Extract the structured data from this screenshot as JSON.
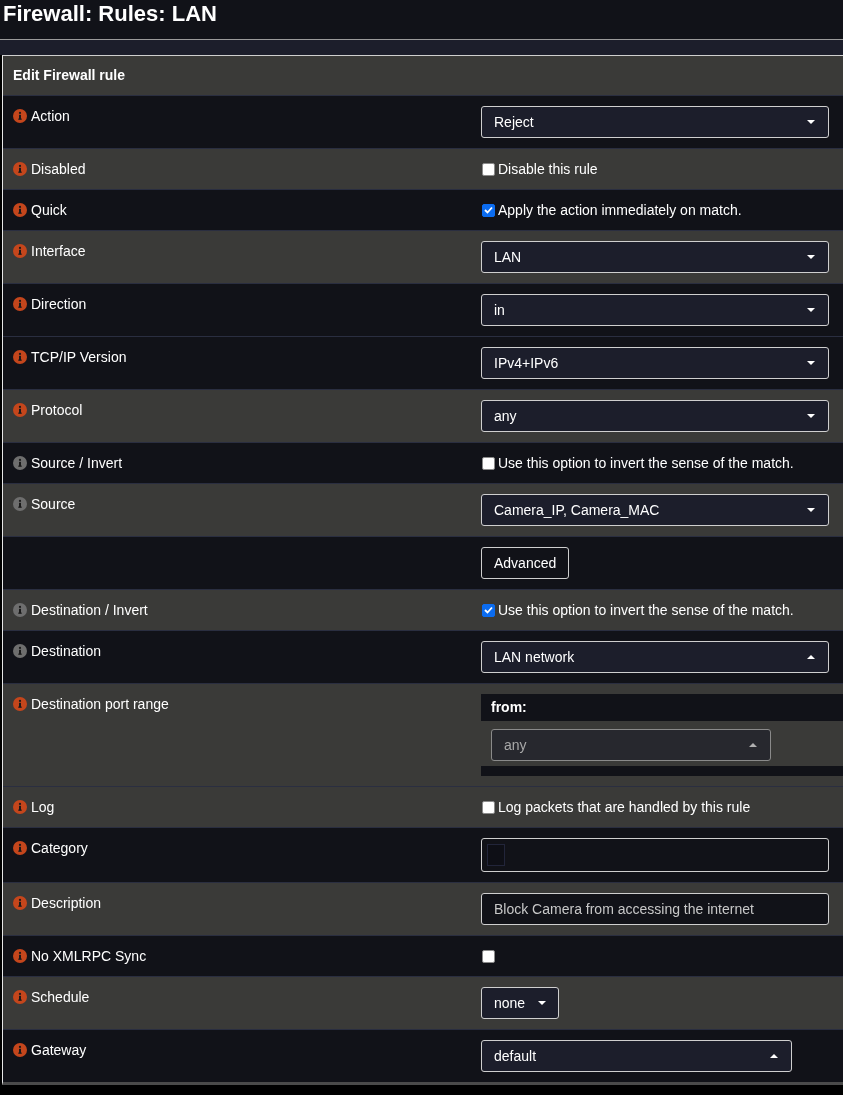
{
  "page": {
    "title": "Firewall: Rules: LAN"
  },
  "panel": {
    "title": "Edit Firewall rule"
  },
  "rows": [
    {
      "label": "Action",
      "color": "#c4461c",
      "shaded": false,
      "control": {
        "kind": "select",
        "value": "Reject",
        "dropup": false
      }
    },
    {
      "label": "Disabled",
      "color": "#c4461c",
      "shaded": true,
      "control": {
        "kind": "checkbox",
        "text": "Disable this rule",
        "checked": false
      }
    },
    {
      "label": "Quick",
      "color": "#c4461c",
      "shaded": false,
      "control": {
        "kind": "checkbox",
        "text": "Apply the action immediately on match.",
        "checked": true
      }
    },
    {
      "label": "Interface",
      "color": "#c4461c",
      "shaded": true,
      "control": {
        "kind": "select",
        "value": "LAN",
        "dropup": false
      }
    },
    {
      "label": "Direction",
      "color": "#c4461c",
      "shaded": false,
      "control": {
        "kind": "select",
        "value": "in",
        "dropup": false
      }
    },
    {
      "label": "TCP/IP Version",
      "color": "#c4461c",
      "shaded": false,
      "control": {
        "kind": "select",
        "value": "IPv4+IPv6",
        "dropup": false
      }
    },
    {
      "label": "Protocol",
      "color": "#c4461c",
      "shaded": true,
      "control": {
        "kind": "select",
        "value": "any",
        "dropup": false
      }
    },
    {
      "label": "Source / Invert",
      "color": "#6e6e6e",
      "shaded": false,
      "control": {
        "kind": "checkbox",
        "text": "Use this option to invert the sense of the match.",
        "checked": false
      }
    },
    {
      "label": "Source",
      "color": "#6e6e6e",
      "shaded": true,
      "control": {
        "kind": "select",
        "value": "Camera_IP, Camera_MAC",
        "dropup": false
      }
    },
    {
      "shaded": false,
      "control": {
        "kind": "button",
        "text": "Advanced"
      }
    },
    {
      "label": "Destination / Invert",
      "color": "#6e6e6e",
      "shaded": true,
      "control": {
        "kind": "checkbox",
        "text": "Use this option to invert the sense of the match.",
        "checked": true
      }
    },
    {
      "label": "Destination",
      "color": "#6e6e6e",
      "shaded": false,
      "control": {
        "kind": "select",
        "value": "LAN network",
        "dropup": true
      }
    },
    {
      "label": "Destination port range",
      "color": "#c4461c",
      "shaded": true,
      "control": {
        "kind": "port_range",
        "heading": "from:",
        "value": "any",
        "dropup": true,
        "disabled": true
      }
    },
    {
      "label": "Log",
      "color": "#c4461c",
      "shaded": true,
      "control": {
        "kind": "checkbox",
        "text": "Log packets that are handled by this rule",
        "checked": false
      }
    },
    {
      "label": "Category",
      "color": "#c4461c",
      "shaded": false,
      "control": {
        "kind": "tags"
      }
    },
    {
      "label": "Description",
      "color": "#c4461c",
      "shaded": true,
      "control": {
        "kind": "text",
        "value": "Block Camera from accessing the internet"
      }
    },
    {
      "label": "No XMLRPC Sync",
      "color": "#c4461c",
      "shaded": false,
      "control": {
        "kind": "checkbox",
        "checked": false
      }
    },
    {
      "label": "Schedule",
      "color": "#c4461c",
      "shaded": true,
      "control": {
        "kind": "menu",
        "value": "none",
        "dropup": false
      }
    },
    {
      "label": "Gateway",
      "color": "#c4461c",
      "shaded": false,
      "control": {
        "kind": "select",
        "value": "default",
        "dropup": true
      }
    }
  ]
}
